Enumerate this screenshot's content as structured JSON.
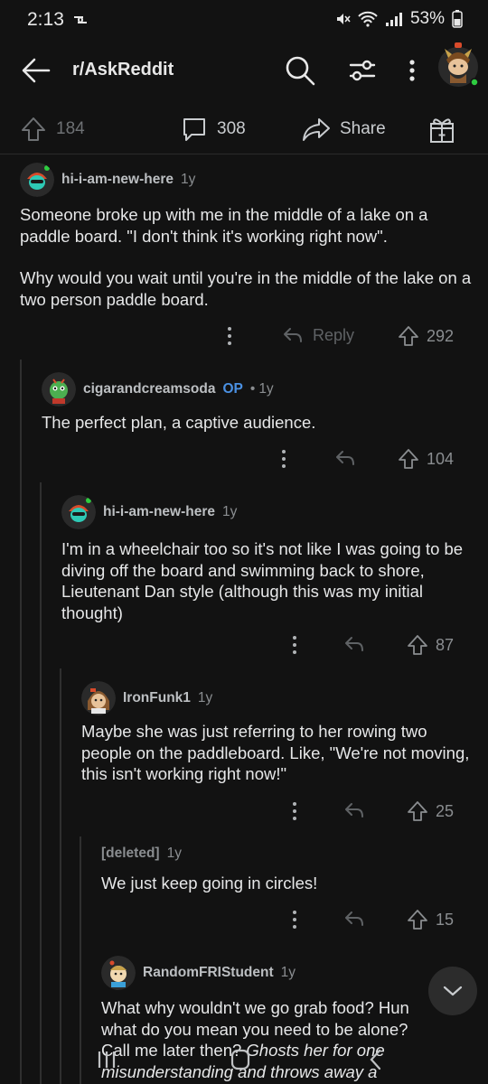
{
  "status": {
    "time": "2:13",
    "battery": "53%"
  },
  "header": {
    "title": "r/AskReddit"
  },
  "post_actions": {
    "upvotes": "184",
    "comments": "308",
    "share": "Share"
  },
  "comments": [
    {
      "user": "hi-i-am-new-here",
      "age": "1y",
      "body": [
        "Someone broke up with me in the middle of a lake on a paddle board. \"I don't think it's working right now\".",
        "Why would you wait until you're in the middle of the lake on a two person paddle board."
      ],
      "reply_label": "Reply",
      "votes": "292"
    },
    {
      "user": "cigarandcreamsoda",
      "op_badge": "OP",
      "sep": "•",
      "age": "1y",
      "body": [
        "The perfect plan, a captive audience."
      ],
      "votes": "104"
    },
    {
      "user": "hi-i-am-new-here",
      "age": "1y",
      "body": [
        "I'm in a wheelchair too so it's not like I was going to be diving off the board and swimming back to shore, Lieutenant Dan style (although this was my initial thought)"
      ],
      "votes": "87"
    },
    {
      "user": "IronFunk1",
      "age": "1y",
      "body": [
        "Maybe she was just referring to her rowing two people on the paddleboard. Like, \"We're not moving, this isn't working right now!\""
      ],
      "votes": "25"
    },
    {
      "user": "[deleted]",
      "age": "1y",
      "body": [
        "We just keep going in circles!"
      ],
      "votes": "15"
    },
    {
      "user": "RandomFRIStudent",
      "age": "1y",
      "body_plain": "What why wouldn't we go grab food? Hun what do you mean you need to be alone? Call me later then? ",
      "body_italic": "Ghosts her for one misunderstanding and throws away a relationship"
    }
  ],
  "colors": {
    "background": "#121212",
    "op_blue": "#4a90e2",
    "online_green": "#2ecc40"
  }
}
